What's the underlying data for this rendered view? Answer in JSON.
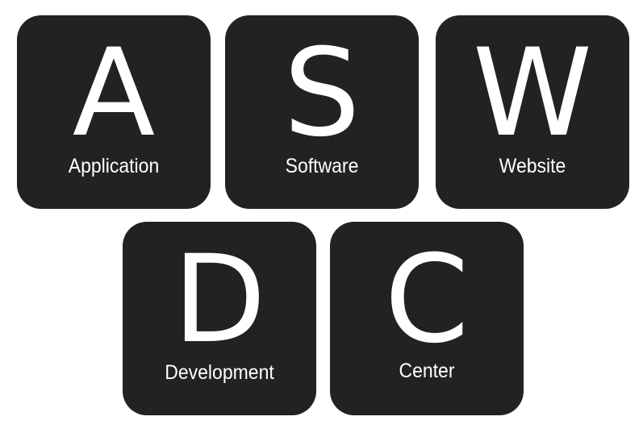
{
  "tiles": [
    {
      "letter": "A",
      "word": "Application"
    },
    {
      "letter": "S",
      "word": "Software"
    },
    {
      "letter": "W",
      "word": "Website"
    },
    {
      "letter": "D",
      "word": "Development"
    },
    {
      "letter": "C",
      "word": "Center"
    }
  ],
  "colors": {
    "tile_background": "#222222",
    "text": "#ffffff",
    "page_background": "#ffffff"
  }
}
